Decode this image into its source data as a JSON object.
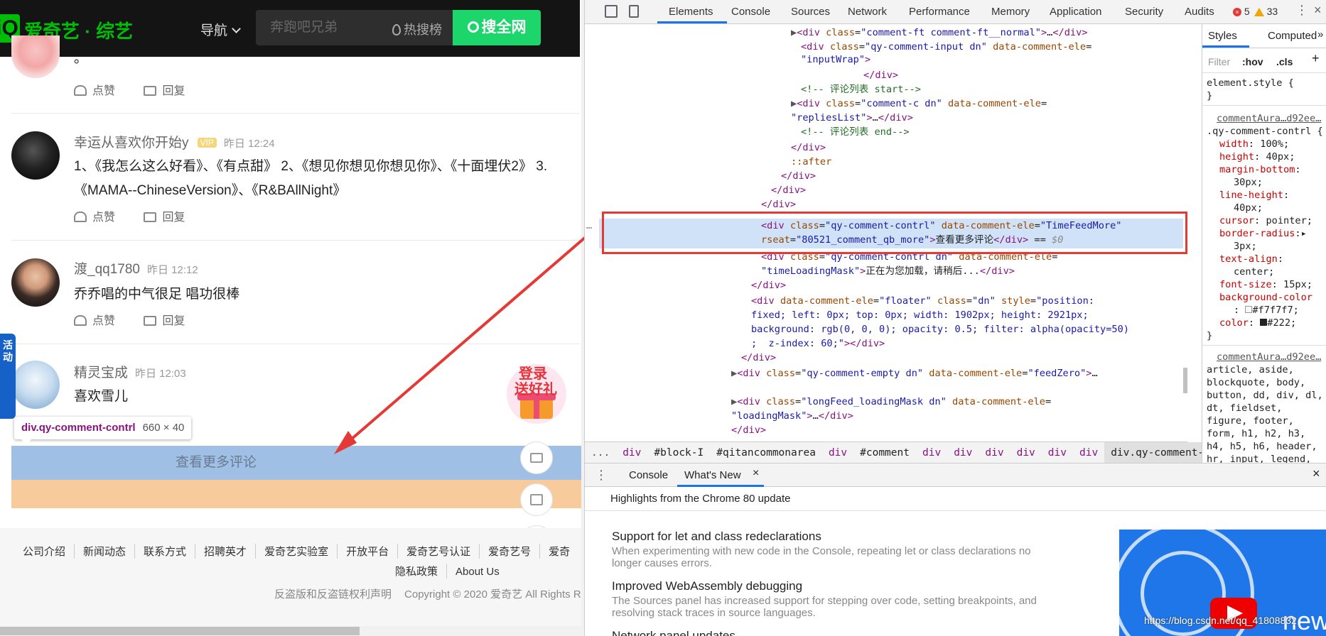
{
  "site": {
    "logo_mark": "iQ",
    "logo_text": "爱奇艺 · 综艺",
    "nav_label": "导航",
    "search_placeholder": "奔跑吧兄弟",
    "hot_label": "热搜榜",
    "search_button": "搜全网"
  },
  "comments": [
    {
      "name": "",
      "time": "",
      "text": "。",
      "like": "点赞",
      "reply": "回复"
    },
    {
      "name": "幸运从喜欢你开始y",
      "time": "昨日 12:24",
      "text_lines": [
        "1、《我怎么这么好看》、《有点甜》 2、《想见你想见你想见你》、《十面埋伏2》 3.",
        "《MAMA--ChineseVersion》、《R&BAllNight》"
      ],
      "like": "点赞",
      "reply": "回复"
    },
    {
      "name": "渡_qq1780",
      "time": "昨日 12:12",
      "text": "乔乔唱的中气很足 唱功很棒",
      "like": "点赞",
      "reply": "回复"
    },
    {
      "name": "精灵宝成",
      "time": "昨日 12:03",
      "text": "喜欢雪儿"
    }
  ],
  "inspect_tooltip": {
    "selector": "div.qy-comment-contrl",
    "size": "660 × 40"
  },
  "more_comments": "查看更多评论",
  "promo": {
    "line1": "登录",
    "line2": "送好礼"
  },
  "side_tab": "活动",
  "footer": {
    "links": [
      "公司介绍",
      "新闻动态",
      "联系方式",
      "招聘英才",
      "爱奇艺实验室",
      "开放平台",
      "爱奇艺号认证",
      "爱奇艺号",
      "爱奇"
    ],
    "links2": [
      "隐私政策",
      "About Us"
    ],
    "copy": "反盗版和反盗链权利声明",
    "copyright": "Copyright © 2020 爱奇艺 All Rights R"
  },
  "devtools": {
    "tabs": [
      "Elements",
      "Console",
      "Sources",
      "Network",
      "Performance",
      "Memory",
      "Application",
      "Security",
      "Audits"
    ],
    "active_tab": "Elements",
    "errors": "5",
    "warnings": "33",
    "breadcrumb": [
      "...",
      "div",
      "#block-I",
      "#qitancommonarea",
      "div",
      "#comment",
      "div",
      "div",
      "div",
      "div",
      "div",
      "div",
      "div.qy-comment-contrl"
    ],
    "styles_tabs": [
      "Styles",
      "Computed"
    ],
    "filter_placeholder": "Filter",
    "hov": ":hov",
    "cls": ".cls",
    "drawer_tabs": [
      "Console",
      "What's New"
    ],
    "whats_new_header": "Highlights from the Chrome 80 update",
    "whats_new": [
      {
        "title": "Support for let and class redeclarations",
        "desc": "When experimenting with new code in the Console, repeating let or class declarations no longer causes errors."
      },
      {
        "title": "Improved WebAssembly debugging",
        "desc": "The Sources panel has increased support for stepping over code, setting breakpoints, and resolving stack traces in source languages."
      },
      {
        "title": "Network panel updates",
        "desc": ""
      }
    ],
    "watermark": "https://blog.csdn.net/qq_41808832",
    "image_text": "new"
  },
  "colors": {
    "brand": "#00be06",
    "search_button": "#1cd66c",
    "highlight_content": "#9fbfe5",
    "highlight_margin": "#f7cb9b",
    "annotation": "#e53935"
  }
}
